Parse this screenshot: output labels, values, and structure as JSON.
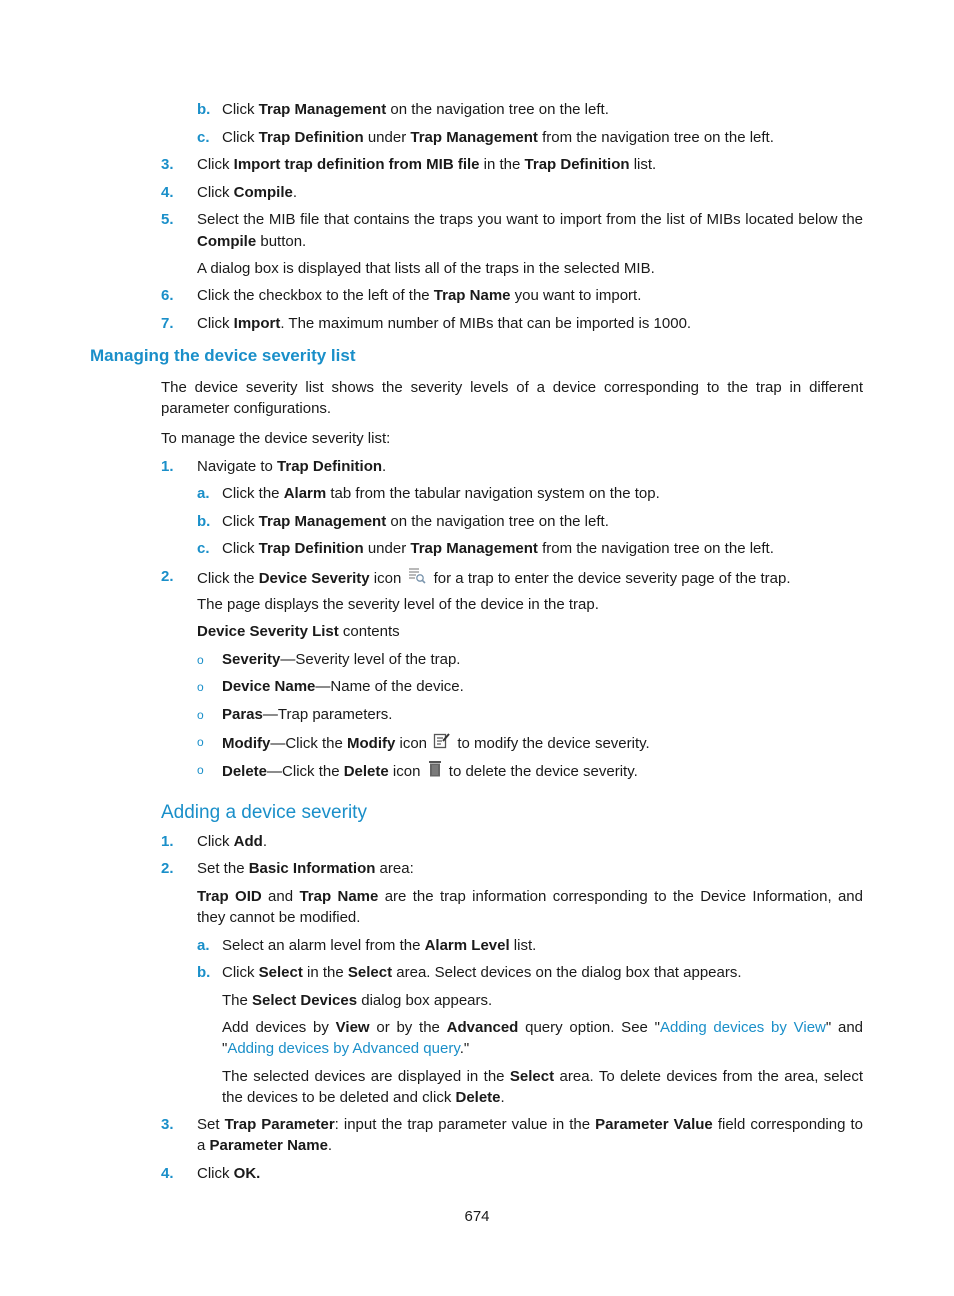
{
  "colors": {
    "accent": "#1a8fc9",
    "text": "#1a1a1a"
  },
  "top_steps": {
    "b": {
      "marker": "b.",
      "pre": "Click ",
      "b1": "Trap Management",
      "post": " on the navigation tree on the left."
    },
    "c": {
      "marker": "c.",
      "pre": "Click ",
      "b1": "Trap Definition",
      "mid": " under ",
      "b2": "Trap Management",
      "post": " from the navigation tree on the left."
    },
    "s3": {
      "marker": "3.",
      "pre": "Click ",
      "b1": "Import trap definition from MIB file",
      "mid": " in the ",
      "b2": "Trap Definition",
      "post": " list."
    },
    "s4": {
      "marker": "4.",
      "pre": "Click ",
      "b1": "Compile",
      "post": "."
    },
    "s5": {
      "marker": "5.",
      "line1": "Select the MIB file that contains the traps you want to import from the list of MIBs located below the",
      "b1": "Compile",
      "post": " button."
    },
    "s5_note": "A dialog box is displayed that lists all of the traps in the selected MIB.",
    "s6": {
      "marker": "6.",
      "pre": "Click the checkbox to the left of the ",
      "b1": "Trap Name",
      "post": " you want to import."
    },
    "s7": {
      "marker": "7.",
      "pre": "Click ",
      "b1": "Import",
      "post": ". The maximum number of MIBs that can be imported is 1000."
    }
  },
  "section_manage": {
    "heading": "Managing the device severity list",
    "intro_line1": "The device severity list shows the severity levels of a device corresponding to the trap in different",
    "intro_line2": "parameter configurations.",
    "lead": "To manage the device severity list:",
    "s1": {
      "marker": "1.",
      "pre": "Navigate to ",
      "b1": "Trap Definition",
      "post": "."
    },
    "s1a": {
      "marker": "a.",
      "pre": "Click the ",
      "b1": "Alarm",
      "post": " tab from the tabular navigation system on the top."
    },
    "s1b": {
      "marker": "b.",
      "pre": "Click ",
      "b1": "Trap Management",
      "post": " on the navigation tree on the left."
    },
    "s1c": {
      "marker": "c.",
      "pre": "Click ",
      "b1": "Trap Definition",
      "mid": " under ",
      "b2": "Trap Management",
      "post": " from the navigation tree on the left."
    },
    "s2": {
      "marker": "2.",
      "pre": "Click the ",
      "b1": "Device Severity",
      "mid": " icon ",
      "post": " for a trap to enter the device severity page of the trap."
    },
    "s2_note": "The page displays the severity level of the device in the trap.",
    "list_title": {
      "b1": "Device Severity List",
      "post": " contents"
    },
    "bullets": [
      {
        "b1": "Severity",
        "post": "—Severity level of the trap."
      },
      {
        "b1": "Device Name",
        "post": "—Name of the device."
      },
      {
        "b1": "Paras",
        "post": "—Trap parameters."
      },
      {
        "b1": "Modify",
        "mid": "—Click the ",
        "b2": "Modify",
        "mid2": " icon ",
        "post": " to modify the device severity.",
        "icon": "edit-icon"
      },
      {
        "b1": "Delete",
        "mid": "—Click the ",
        "b2": "Delete",
        "mid2": " icon ",
        "post": " to delete the device severity.",
        "icon": "trash-icon"
      }
    ],
    "bullet_marker": "o"
  },
  "section_add": {
    "heading": "Adding a device severity",
    "s1": {
      "marker": "1.",
      "pre": "Click ",
      "b1": "Add",
      "post": "."
    },
    "s2": {
      "marker": "2.",
      "pre": "Set the ",
      "b1": "Basic Information",
      "post": " area:"
    },
    "s2_note": {
      "b1": "Trap OID",
      "mid": " and ",
      "b2": "Trap Name",
      "line1_post": " are the trap information corresponding to the Device Information, and",
      "line2": "they cannot be modified."
    },
    "s2a": {
      "marker": "a.",
      "pre": "Select an alarm level from the ",
      "b1": "Alarm Level",
      "post": " list."
    },
    "s2b": {
      "marker": "b.",
      "pre": "Click ",
      "b1": "Select",
      "mid": " in the ",
      "b2": "Select",
      "post": " area. Select devices on the dialog box that appears."
    },
    "s2b_note1": {
      "pre": "The ",
      "b1": "Select Devices",
      "post": " dialog box appears."
    },
    "s2b_note2": {
      "pre": "Add devices by ",
      "b1": "View",
      "mid": " or by the ",
      "b2": "Advanced",
      "mid2": " query option. See \"",
      "link1": "Adding devices by View",
      "mid3": "\" and",
      "line2_pre": "\"",
      "link2": "Adding devices by Advanced query",
      "line2_post": ".\""
    },
    "s2b_note3": {
      "pre": "The selected devices are displayed in the ",
      "b1": "Select",
      "post": " area. To delete devices from the area, select",
      "line2_pre": "the devices to be deleted and click ",
      "b2": "Delete",
      "line2_post": "."
    },
    "s3": {
      "marker": "3.",
      "pre": "Set ",
      "b1": "Trap Parameter",
      "mid": ": input the trap parameter value in the ",
      "b2": "Parameter Value",
      "post": " field corresponding to",
      "line2_pre": "a ",
      "b3": "Parameter Name",
      "line2_post": "."
    },
    "s4": {
      "marker": "4.",
      "pre": "Click ",
      "b1": "OK."
    }
  },
  "footer": {
    "page_number": "674"
  }
}
